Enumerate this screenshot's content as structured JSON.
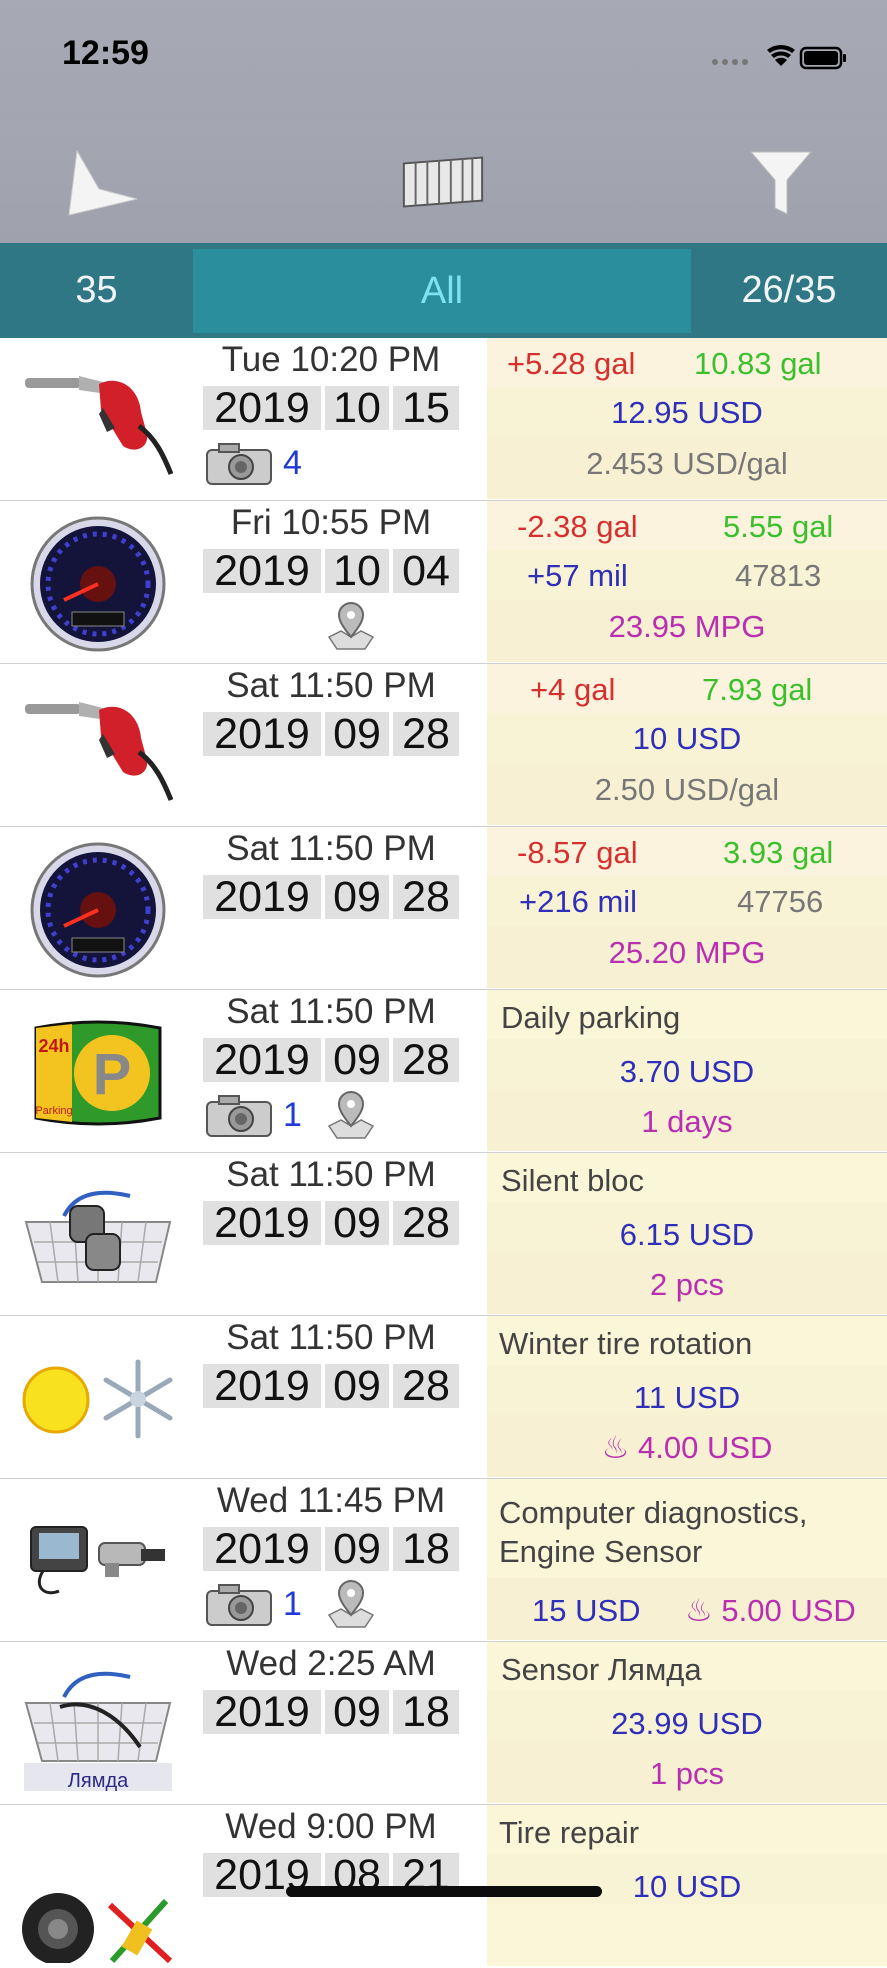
{
  "status_bar": {
    "time": "12:59"
  },
  "nav": {
    "left": "navigation-arrow-icon",
    "center": "stack-icon",
    "right": "filter-icon"
  },
  "segments": {
    "left": "35",
    "middle": "All",
    "right": "26/35"
  },
  "rows": [
    {
      "icon": "fuel-nozzle-icon",
      "time": "Tue 10:20 PM",
      "year": "2019",
      "month": "10",
      "day": "15",
      "photo_count": "4",
      "has_location": false,
      "top_left": "+5.28 gal",
      "top_right": "10.83 gal",
      "mid_left": "12.95 USD",
      "mid_right": "",
      "bottom": "2.453 USD/gal"
    },
    {
      "icon": "speedometer-icon",
      "time": "Fri 10:55 PM",
      "year": "2019",
      "month": "10",
      "day": "04",
      "photo_count": "",
      "has_location": true,
      "top_left": "-2.38 gal",
      "top_right": "5.55 gal",
      "mid_left": "+57 mil",
      "mid_right": "47813",
      "bottom": "23.95 MPG"
    },
    {
      "icon": "fuel-nozzle-icon",
      "time": "Sat 11:50 PM",
      "year": "2019",
      "month": "09",
      "day": "28",
      "photo_count": "",
      "has_location": false,
      "top_left": "+4 gal",
      "top_right": "7.93 gal",
      "mid_left": "10 USD",
      "mid_right": "",
      "bottom": "2.50 USD/gal"
    },
    {
      "icon": "speedometer-icon",
      "time": "Sat 11:50 PM",
      "year": "2019",
      "month": "09",
      "day": "28",
      "photo_count": "",
      "has_location": false,
      "top_left": "-8.57 gal",
      "top_right": "3.93 gal",
      "mid_left": "+216 mil",
      "mid_right": "47756",
      "bottom": "25.20 MPG"
    },
    {
      "icon": "parking-icon",
      "time": "Sat 11:50 PM",
      "year": "2019",
      "month": "09",
      "day": "28",
      "photo_count": "1",
      "has_location": true,
      "title": "Daily parking",
      "amount": "3.70 USD",
      "detail": "1 days"
    },
    {
      "icon": "basket-icon",
      "time": "Sat 11:50 PM",
      "year": "2019",
      "month": "09",
      "day": "28",
      "photo_count": "",
      "has_location": false,
      "title": "Silent bloc",
      "amount": "6.15 USD",
      "detail": "2 pcs"
    },
    {
      "icon": "sun-snowflake-icon",
      "time": "Sat 11:50 PM",
      "year": "2019",
      "month": "09",
      "day": "28",
      "photo_count": "",
      "has_location": false,
      "title": "Winter tire rotation",
      "amount": "11 USD",
      "detail": "♨ 4.00 USD"
    },
    {
      "icon": "diagnostics-icon",
      "time": "Wed 11:45 PM",
      "year": "2019",
      "month": "09",
      "day": "18",
      "photo_count": "1",
      "has_location": true,
      "title": "Computer diagnostics, Engine Sensor",
      "amount": "15 USD",
      "detail": "♨ 5.00 USD"
    },
    {
      "icon": "basket-icon",
      "icon_caption": "Лямда",
      "time": "Wed 2:25 AM",
      "year": "2019",
      "month": "09",
      "day": "18",
      "photo_count": "",
      "has_location": false,
      "title": "Sensor Лямда",
      "amount": "23.99 USD",
      "detail": "1 pcs"
    },
    {
      "icon": "tire-repair-icon",
      "time": "Wed 9:00 PM",
      "year": "2019",
      "month": "08",
      "day": "21",
      "photo_count": "",
      "has_location": false,
      "title": "Tire repair",
      "amount": "10 USD",
      "detail": ""
    }
  ]
}
